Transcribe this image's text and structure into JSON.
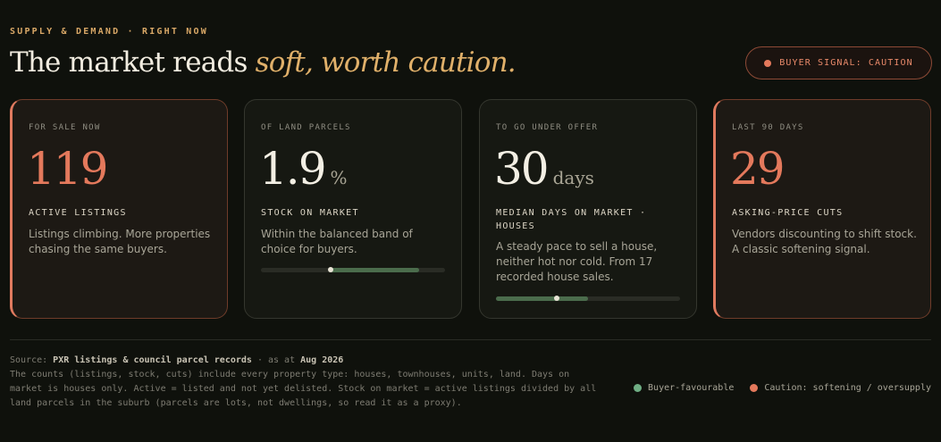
{
  "header": {
    "eyebrow": "SUPPLY & DEMAND · RIGHT NOW",
    "headline_lead": "The market reads ",
    "headline_emph": "soft, worth caution."
  },
  "signal": {
    "label": "BUYER SIGNAL: CAUTION",
    "color": "#e4795c"
  },
  "cards": [
    {
      "eyebrow": "FOR SALE NOW",
      "value": "119",
      "unit": "",
      "title": "ACTIVE LISTINGS",
      "description": "Listings climbing. More properties chasing the same buyers.",
      "tone": "caution"
    },
    {
      "eyebrow": "OF LAND PARCELS",
      "value": "1.9",
      "unit": "%",
      "title": "STOCK ON MARKET",
      "description": "Within the balanced band of choice for buyers.",
      "tone": "favourable",
      "gauge": {
        "marker": 0.38,
        "band_start": 0.38,
        "band_end": 0.86
      }
    },
    {
      "eyebrow": "TO GO UNDER OFFER",
      "value": "30",
      "unit": "days",
      "title": "MEDIAN DAYS ON MARKET · HOUSES",
      "description": "A steady pace to sell a house, neither hot nor cold. From 17 recorded house sales.",
      "tone": "favourable",
      "gauge": {
        "marker": 0.33,
        "band_start": 0.0,
        "band_end": 0.5
      }
    },
    {
      "eyebrow": "LAST 90 DAYS",
      "value": "29",
      "unit": "",
      "title": "ASKING-PRICE CUTS",
      "description": "Vendors discounting to shift stock. A classic softening signal.",
      "tone": "caution"
    }
  ],
  "footer": {
    "source_prefix": "Source: ",
    "source_name": "PXR listings & council parcel records",
    "as_at_prefix": " · as at ",
    "as_at": "Aug 2026",
    "notes": "The counts (listings, stock, cuts) include every property type: houses, townhouses, units, land. Days on market is houses only. Active = listed and not yet delisted. Stock on market = active listings divided by all land parcels in the suburb (parcels are lots, not dwellings, so read it as a proxy)."
  },
  "legend": [
    {
      "label": "Buyer-favourable",
      "color": "#6fae84"
    },
    {
      "label": "Caution: softening / oversupply",
      "color": "#e4795c"
    }
  ]
}
